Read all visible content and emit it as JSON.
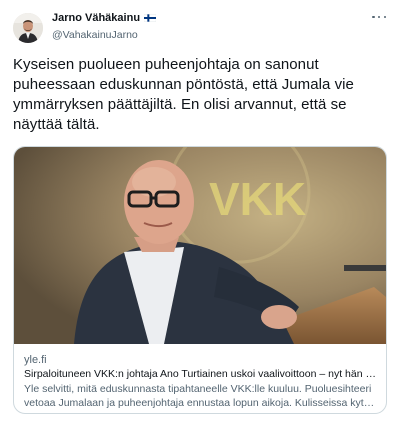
{
  "author": {
    "display_name": "Jarno Vähäkainu",
    "handle": "@VahakainuJarno",
    "flag_icon": "finland-flag-icon"
  },
  "menu": {
    "icon": "more-horizontal-icon"
  },
  "tweet": {
    "text": "Kyseisen puolueen puheenjohtaja on sanonut puheessaan eduskunnan pöntöstä, että Jumala vie ymmärryksen päättäjiltä. En olisi arvannut, että se näyttää tältä."
  },
  "card": {
    "image_text": "VKK",
    "domain": "yle.fi",
    "title": "Sirpaloituneen VKK:n johtaja Ano Turtiainen uskoi vaalivoittoon – nyt hän sa...",
    "description": "Yle selvitti, mitä eduskunnasta tipahtaneelle VKK:lle kuuluu. Puoluesihteeri vetoaa Jumalaan ja puheenjohtaja ennustaa lopun aikoja. Kulisseissa kytee ..."
  },
  "colors": {
    "text_primary": "#0f1419",
    "text_secondary": "#536471",
    "border": "#cfd9de",
    "flag_blue": "#003580"
  }
}
